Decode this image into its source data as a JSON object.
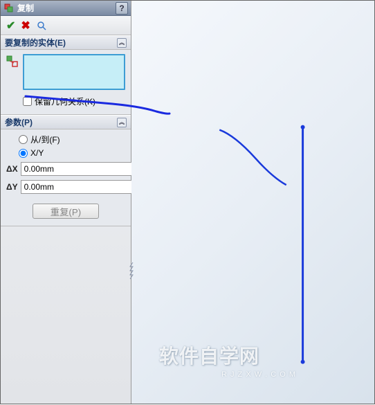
{
  "title": "复制",
  "help_label": "?",
  "sections": {
    "entities": {
      "header": "要复制的实体(E)",
      "keep_relations_label": "保留几何关系(K)",
      "keep_relations_checked": false
    },
    "params": {
      "header": "参数(P)",
      "radio_from_to": "从/到(F)",
      "radio_xy": "X/Y",
      "radio_selected": "xy",
      "dx_label": "ΔX",
      "dx_value": "0.00mm",
      "dy_label": "ΔY",
      "dy_value": "0.00mm",
      "repeat_label": "重复(P)"
    }
  },
  "watermark": {
    "main": "软件自学网",
    "sub": "R  J  Z  X  W  .  C  O  M"
  }
}
